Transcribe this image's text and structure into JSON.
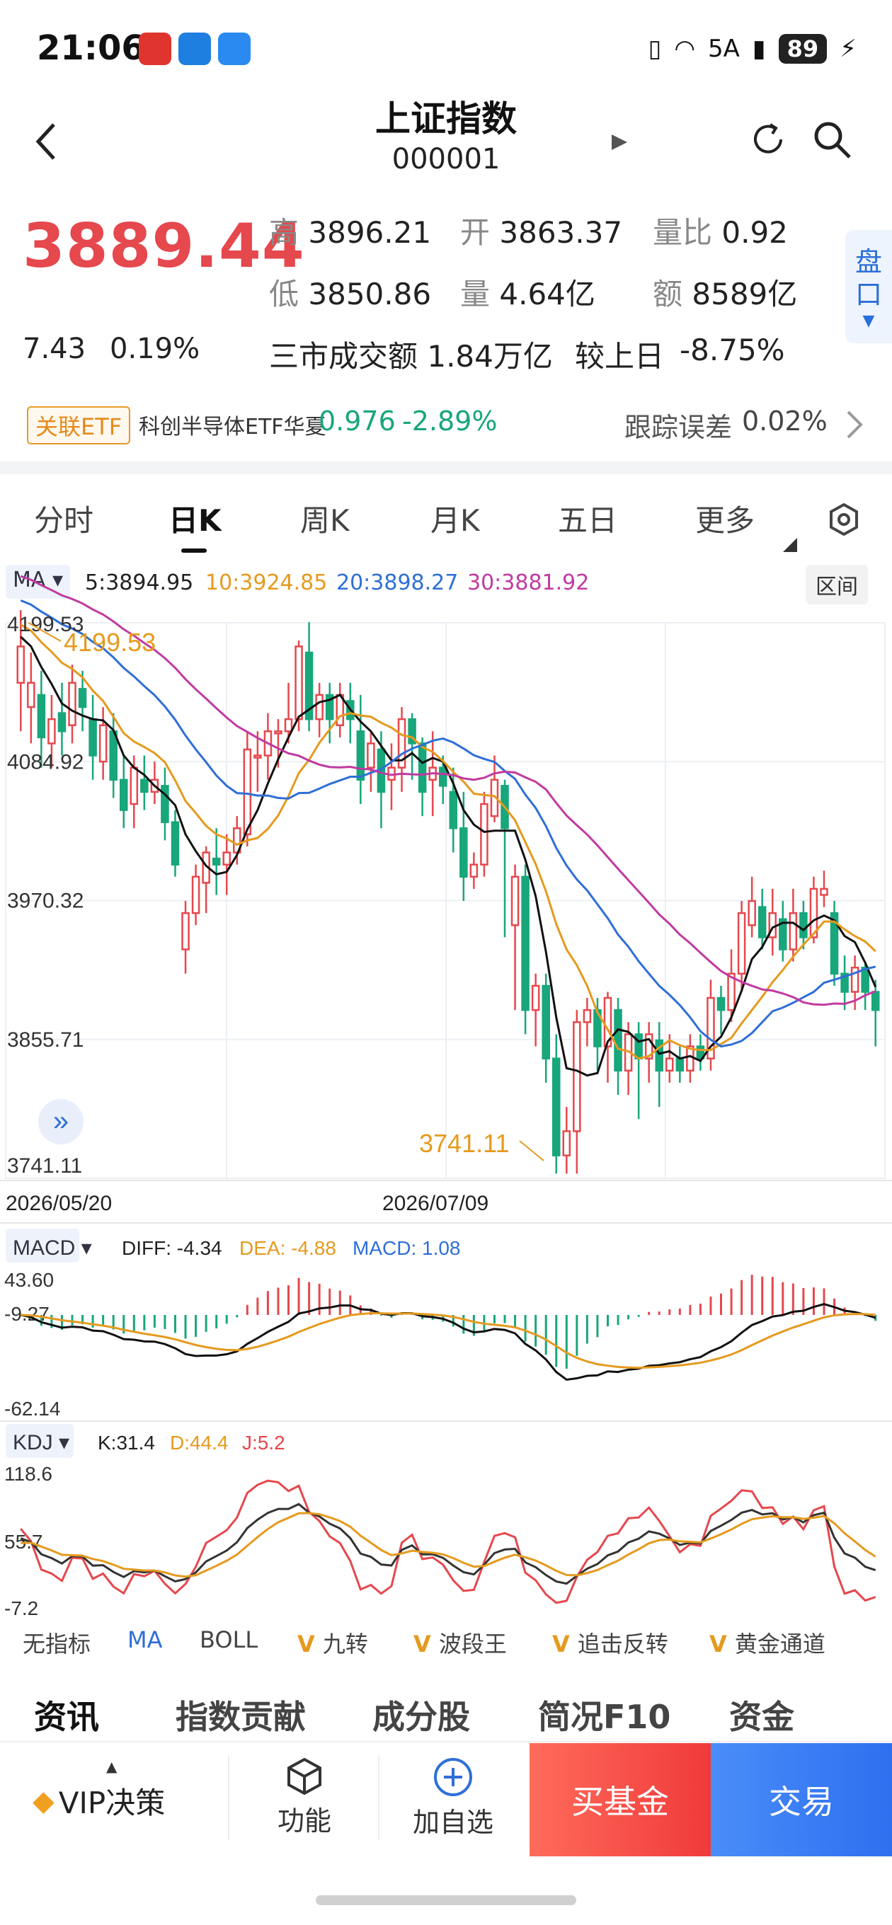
{
  "status": {
    "time": "21:06",
    "network": "5A",
    "battery": "89"
  },
  "header": {
    "title": "上证指数",
    "code": "000001"
  },
  "quote": {
    "price": "3889.44",
    "change": "7.43",
    "change_pct": "0.19%",
    "high_label": "高",
    "high": "3896.21",
    "open_label": "开",
    "open": "3863.37",
    "vol_ratio_label": "量比",
    "vol_ratio": "0.92",
    "low_label": "低",
    "low": "3850.86",
    "vol_label": "量",
    "vol": "4.64亿",
    "amount_label": "额",
    "amount": "8589亿",
    "market_turnover": "三市成交额 1.84万亿",
    "vs_prev_label": "较上日",
    "vs_prev": "-8.75%",
    "pankou": "盘口"
  },
  "etf": {
    "tag": "关联ETF",
    "name": "科创半导体ETF华夏",
    "price": "0.976",
    "change_pct": "-2.89%",
    "tracking_label": "跟踪误差",
    "tracking_value": "0.02%"
  },
  "tabs": [
    "分时",
    "日K",
    "周K",
    "月K",
    "五日",
    "更多"
  ],
  "ma": {
    "label": "MA",
    "ma5": "5:3894.95",
    "ma10": "10:3924.85",
    "ma20": "20:3898.27",
    "ma30": "30:3881.92",
    "range_button": "区间"
  },
  "macd": {
    "label": "MACD",
    "diff": "DIFF: -4.34",
    "dea": "DEA: -4.88",
    "macd": "MACD: 1.08",
    "ticks": [
      "43.60",
      "-9.27",
      "-62.14"
    ]
  },
  "kdj": {
    "label": "KDJ",
    "k": "K:31.4",
    "d": "D:44.4",
    "j": "J:5.2",
    "ticks": [
      "118.6",
      "55.7",
      "-7.2"
    ]
  },
  "indicators": [
    "无指标",
    "MA",
    "BOLL",
    "九转",
    "波段王",
    "追击反转",
    "黄金通道"
  ],
  "bottom_tabs": [
    "资讯",
    "指数贡献",
    "成分股",
    "简况F10",
    "资金"
  ],
  "footer": {
    "vip": "VIP决策",
    "func": "功能",
    "add": "加自选",
    "buy": "买基金",
    "trade": "交易"
  },
  "colors": {
    "up": "#e5484d",
    "down": "#18a67b",
    "ma5": "#111111",
    "ma10": "#e59a1e",
    "ma20": "#2f6fd6",
    "ma30": "#c13aa0"
  },
  "chart_data": {
    "type": "candlestick",
    "y_ticks": [
      "4199.53",
      "4084.92",
      "3970.32",
      "3855.71",
      "3741.11"
    ],
    "ylim": [
      3741.11,
      4199.53
    ],
    "x_labels": [
      "2026/05/20",
      "2026/07/09"
    ],
    "annotations": {
      "high": "4199.53",
      "low": "3741.11"
    },
    "candles": [
      [
        4150,
        4180,
        4210,
        4110
      ],
      [
        4130,
        4150,
        4175,
        4100
      ],
      [
        4140,
        4105,
        4160,
        4080
      ],
      [
        4100,
        4120,
        4140,
        4080
      ],
      [
        4125,
        4110,
        4150,
        4090
      ],
      [
        4115,
        4150,
        4165,
        4100
      ],
      [
        4145,
        4130,
        4160,
        4110
      ],
      [
        4120,
        4090,
        4140,
        4070
      ],
      [
        4085,
        4115,
        4130,
        4070
      ],
      [
        4110,
        4070,
        4125,
        4055
      ],
      [
        4070,
        4045,
        4090,
        4030
      ],
      [
        4050,
        4080,
        4090,
        4030
      ],
      [
        4070,
        4060,
        4090,
        4045
      ],
      [
        4060,
        4070,
        4085,
        4050
      ],
      [
        4065,
        4035,
        4080,
        4020
      ],
      [
        4035,
        4000,
        4045,
        3990
      ],
      [
        3930,
        3960,
        3970,
        3910
      ],
      [
        3960,
        3990,
        4000,
        3950
      ],
      [
        3985,
        4010,
        4015,
        3960
      ],
      [
        4005,
        4000,
        4030,
        3975
      ],
      [
        4000,
        4010,
        4025,
        3975
      ],
      [
        4010,
        4030,
        4040,
        4000
      ],
      [
        4025,
        4095,
        4110,
        4015
      ],
      [
        4090,
        4090,
        4110,
        4060
      ],
      [
        4090,
        4110,
        4125,
        4070
      ],
      [
        4110,
        4110,
        4120,
        4080
      ],
      [
        4110,
        4120,
        4150,
        4100
      ],
      [
        4120,
        4180,
        4185,
        4110
      ],
      [
        4175,
        4120,
        4200,
        4110
      ],
      [
        4120,
        4140,
        4150,
        4105
      ],
      [
        4140,
        4120,
        4150,
        4100
      ],
      [
        4115,
        4140,
        4150,
        4105
      ],
      [
        4135,
        4120,
        4150,
        4100
      ],
      [
        4110,
        4070,
        4140,
        4050
      ],
      [
        4080,
        4100,
        4110,
        4060
      ],
      [
        4095,
        4060,
        4110,
        4030
      ],
      [
        4070,
        4080,
        4100,
        4045
      ],
      [
        4080,
        4120,
        4130,
        4060
      ],
      [
        4120,
        4100,
        4125,
        4070
      ],
      [
        4100,
        4060,
        4105,
        4040
      ],
      [
        4070,
        4080,
        4110,
        4040
      ],
      [
        4080,
        4065,
        4090,
        4050
      ],
      [
        4060,
        4030,
        4080,
        4010
      ],
      [
        4030,
        3990,
        4060,
        3970
      ],
      [
        3990,
        4000,
        4010,
        3980
      ],
      [
        4000,
        4050,
        4060,
        3990
      ],
      [
        4040,
        4070,
        4090,
        4035
      ],
      [
        4065,
        4030,
        4070,
        3940
      ],
      [
        3950,
        3990,
        4000,
        3880
      ],
      [
        3990,
        3880,
        4000,
        3860
      ],
      [
        3880,
        3900,
        3910,
        3850
      ],
      [
        3900,
        3840,
        3910,
        3820
      ],
      [
        3840,
        3760,
        3860,
        3745
      ],
      [
        3760,
        3780,
        3800,
        3745
      ],
      [
        3780,
        3870,
        3880,
        3745
      ],
      [
        3870,
        3880,
        3890,
        3850
      ],
      [
        3880,
        3850,
        3890,
        3830
      ],
      [
        3850,
        3890,
        3895,
        3820
      ],
      [
        3880,
        3830,
        3890,
        3810
      ],
      [
        3830,
        3860,
        3870,
        3810
      ],
      [
        3860,
        3840,
        3870,
        3790
      ],
      [
        3840,
        3860,
        3870,
        3820
      ],
      [
        3855,
        3830,
        3870,
        3800
      ],
      [
        3830,
        3840,
        3860,
        3820
      ],
      [
        3840,
        3830,
        3850,
        3820
      ],
      [
        3830,
        3850,
        3860,
        3820
      ],
      [
        3850,
        3840,
        3860,
        3830
      ],
      [
        3840,
        3890,
        3905,
        3830
      ],
      [
        3890,
        3880,
        3900,
        3860
      ],
      [
        3880,
        3910,
        3930,
        3870
      ],
      [
        3910,
        3960,
        3970,
        3895
      ],
      [
        3950,
        3970,
        3990,
        3940
      ],
      [
        3965,
        3940,
        3980,
        3930
      ],
      [
        3940,
        3960,
        3980,
        3925
      ],
      [
        3955,
        3930,
        3970,
        3920
      ],
      [
        3930,
        3960,
        3980,
        3920
      ],
      [
        3960,
        3940,
        3970,
        3930
      ],
      [
        3940,
        3980,
        3990,
        3935
      ],
      [
        3975,
        3980,
        3995,
        3965
      ],
      [
        3960,
        3910,
        3970,
        3900
      ],
      [
        3910,
        3895,
        3925,
        3880
      ],
      [
        3895,
        3915,
        3925,
        3880
      ],
      [
        3915,
        3895,
        3920,
        3880
      ],
      [
        3895,
        3880,
        3905,
        3850
      ]
    ]
  }
}
